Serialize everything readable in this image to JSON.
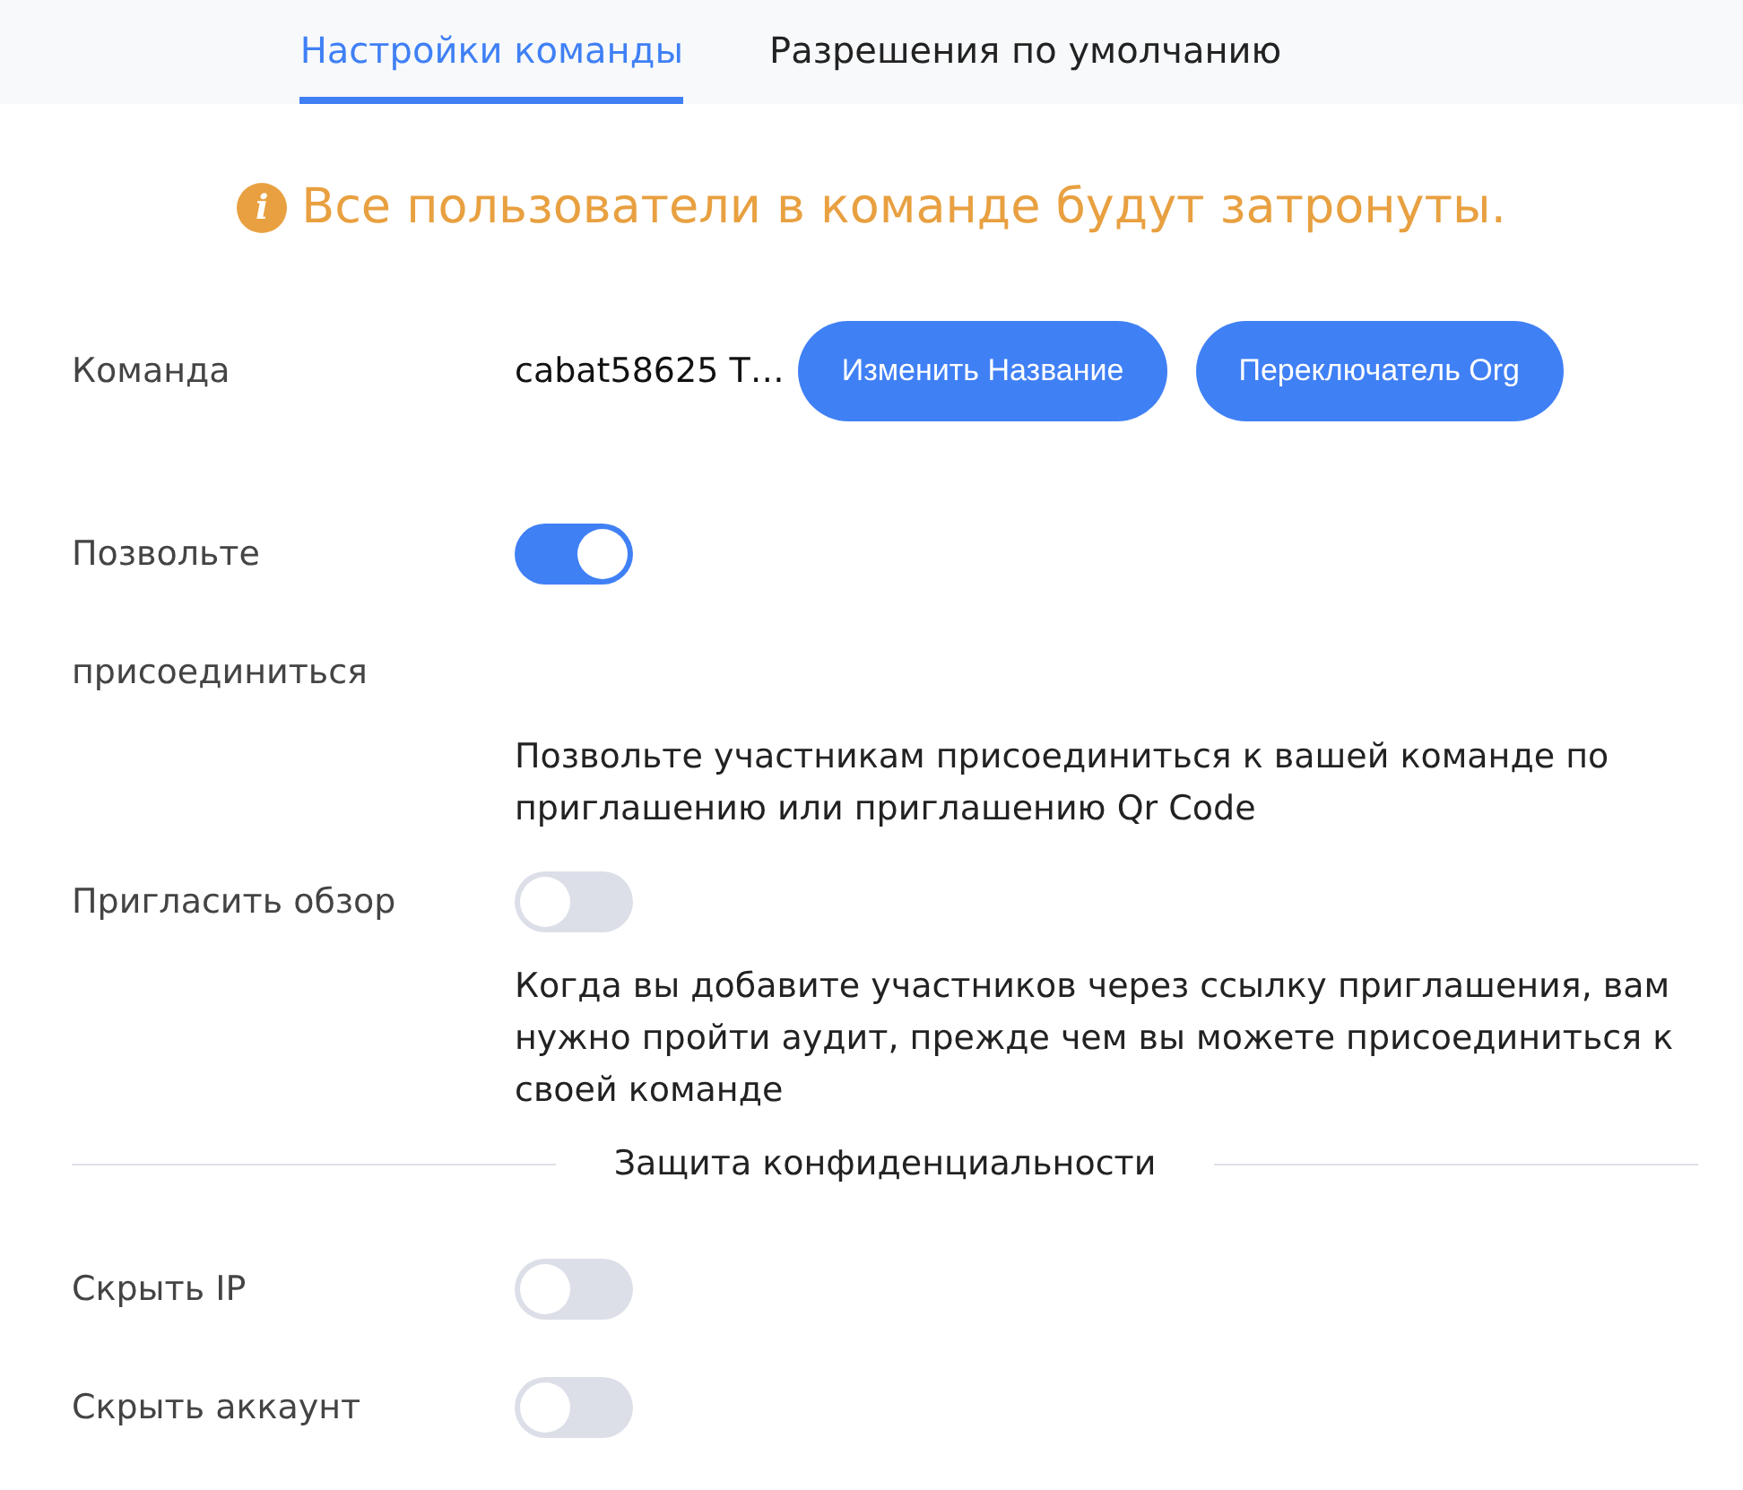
{
  "tabs": [
    {
      "label": "Настройки команды",
      "selected": true
    },
    {
      "label": "Разрешения по умолчанию",
      "selected": false
    }
  ],
  "notice": {
    "icon": "i",
    "text": "Все пользователи в команде будут затронуты."
  },
  "team": {
    "label": "Команда",
    "name": "cabat58625 T…",
    "buttons": [
      "Изменить Название",
      "Переключатель Org"
    ]
  },
  "settings": [
    {
      "label": "Позвольте присоединиться",
      "on": true,
      "description": "Позвольте участникам присоединиться к вашей команде по приглашению или приглашению Qr Code"
    },
    {
      "label": "Пригласить обзор",
      "on": false,
      "description": "Когда вы добавите участников через ссылку приглашения, вам нужно пройти аудит, прежде чем вы можете присоединиться к своей команде"
    }
  ],
  "section": {
    "title": "Защита конфиденциальности"
  },
  "privacy": [
    {
      "label": "Скрыть IP",
      "on": false
    },
    {
      "label": "Скрыть аккаунт",
      "on": false
    }
  ]
}
